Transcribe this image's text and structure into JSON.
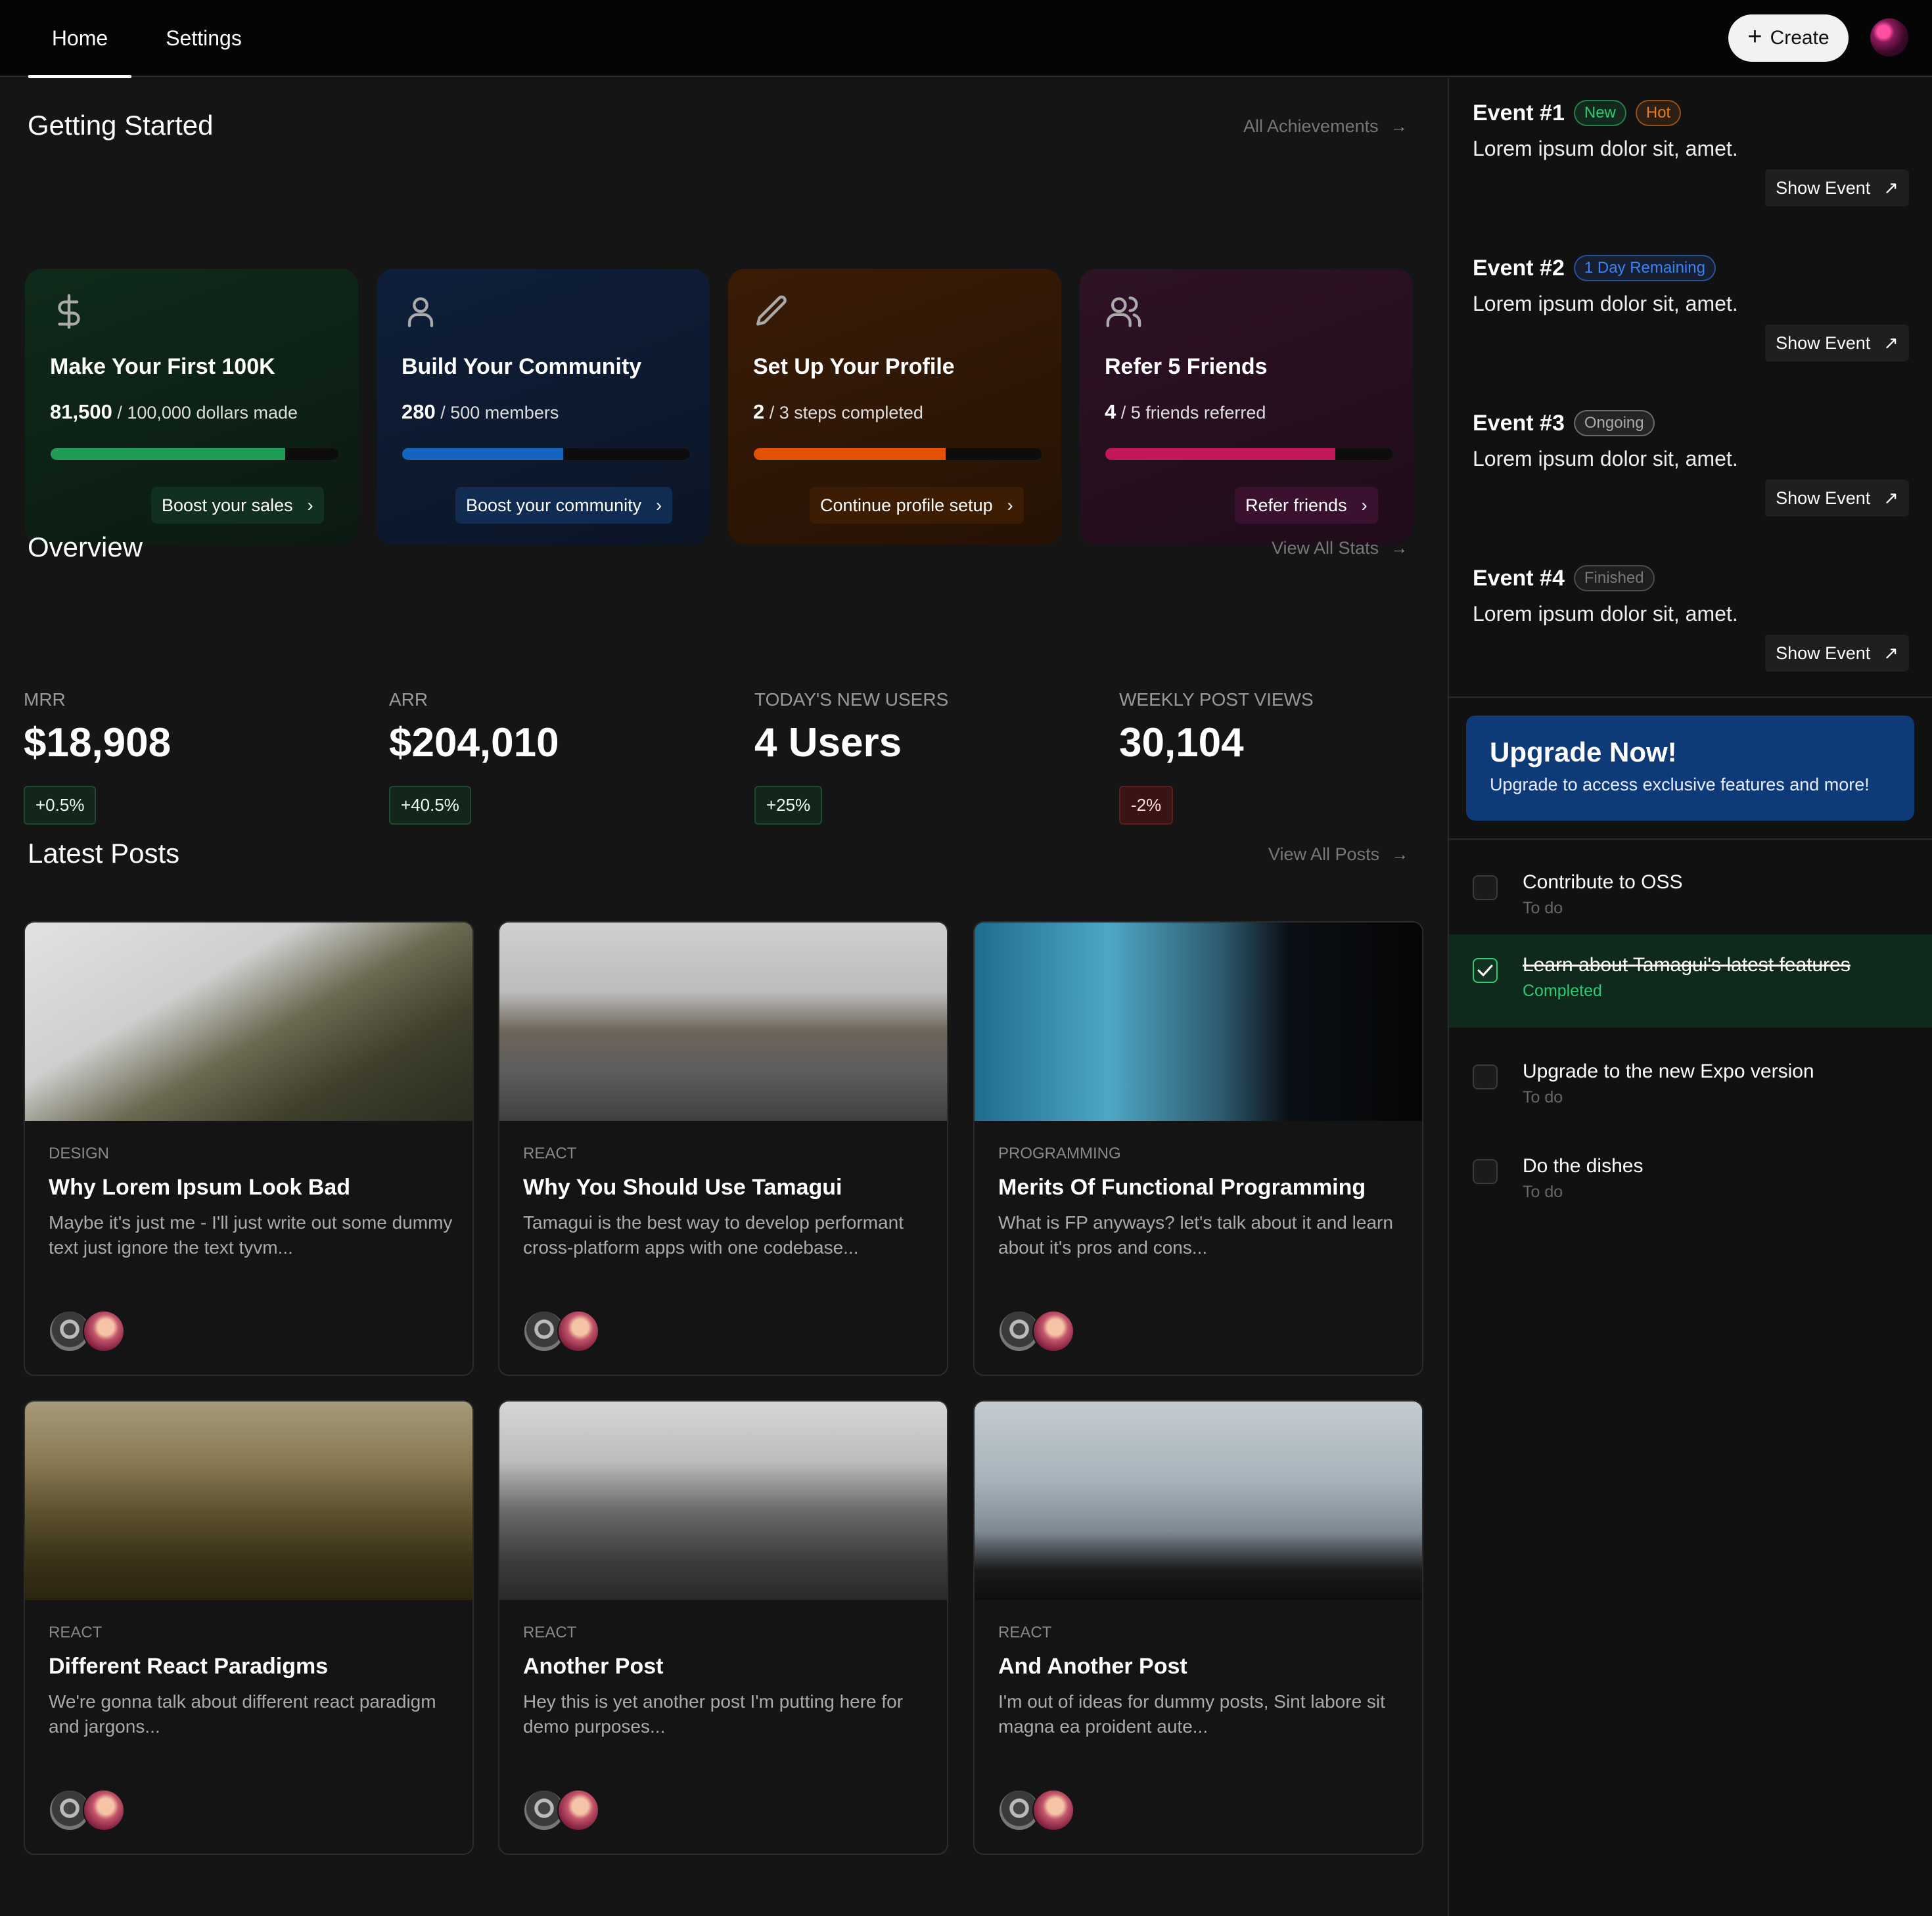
{
  "nav": {
    "tabs": [
      {
        "label": "Home"
      },
      {
        "label": "Settings"
      }
    ],
    "create_label": "Create"
  },
  "getting_started": {
    "title": "Getting Started",
    "link": "All Achievements",
    "cards": [
      {
        "icon": "dollar-icon",
        "title": "Make Your First 100K",
        "current": "81,500",
        "rest": "/ 100,000 dollars made",
        "progress": 0.815,
        "button": "Boost your sales",
        "accent": "#1f9d55"
      },
      {
        "icon": "user-icon",
        "title": "Build Your Community",
        "current": "280",
        "rest": "/ 500 members",
        "progress": 0.56,
        "button": "Boost your community",
        "accent": "#1565c0"
      },
      {
        "icon": "pencil-icon",
        "title": "Set Up Your Profile",
        "current": "2",
        "rest": "/ 3 steps completed",
        "progress": 0.667,
        "button": "Continue profile setup",
        "accent": "#e65100"
      },
      {
        "icon": "users-icon",
        "title": "Refer 5 Friends",
        "current": "4",
        "rest": "/ 5 friends referred",
        "progress": 0.8,
        "button": "Refer friends",
        "accent": "#c2185b"
      }
    ]
  },
  "overview": {
    "title": "Overview",
    "link": "View All Stats",
    "stats": [
      {
        "label": "MRR",
        "value": "$18,908",
        "change": "+0.5%",
        "positive": true
      },
      {
        "label": "ARR",
        "value": "$204,010",
        "change": "+40.5%",
        "positive": true
      },
      {
        "label": "Today's New Users",
        "value": "4 Users",
        "change": "+25%",
        "positive": true
      },
      {
        "label": "Weekly Post Views",
        "value": "30,104",
        "change": "-2%",
        "positive": false
      }
    ]
  },
  "posts": {
    "title": "Latest Posts",
    "link": "View All Posts",
    "items": [
      {
        "category": "Design",
        "title": "Why Lorem Ipsum Look Bad",
        "desc": "Maybe it's just me - I'll just write out some dummy text just ignore the text tyvm..."
      },
      {
        "category": "React",
        "title": "Why You Should Use Tamagui",
        "desc": "Tamagui is the best way to develop performant cross-platform apps with one codebase..."
      },
      {
        "category": "Programming",
        "title": "Merits Of Functional Programming",
        "desc": "What is FP anyways? let's talk about it and learn about it's pros and cons..."
      },
      {
        "category": "React",
        "title": "Different React Paradigms",
        "desc": "We're gonna talk about different react paradigm and jargons..."
      },
      {
        "category": "React",
        "title": "Another Post",
        "desc": "Hey this is yet another post I'm putting here for demo purposes..."
      },
      {
        "category": "React",
        "title": "And Another Post",
        "desc": "I'm out of ideas for dummy posts, Sint labore sit magna ea proident aute..."
      }
    ]
  },
  "events": [
    {
      "title": "Event #1",
      "tags": [
        {
          "label": "New",
          "color": "#2ecc71"
        },
        {
          "label": "Hot",
          "color": "#e67e22"
        }
      ],
      "desc": "Lorem ipsum dolor sit, amet.",
      "button": "Show Event"
    },
    {
      "title": "Event #2",
      "tags": [
        {
          "label": "1 Day Remaining",
          "color": "#3b82f6"
        }
      ],
      "desc": "Lorem ipsum dolor sit, amet.",
      "button": "Show Event"
    },
    {
      "title": "Event #3",
      "tags": [
        {
          "label": "Ongoing",
          "color": "#aaaaaa"
        }
      ],
      "desc": "Lorem ipsum dolor sit, amet.",
      "button": "Show Event"
    },
    {
      "title": "Event #4",
      "tags": [
        {
          "label": "Finished",
          "color": "#777777"
        }
      ],
      "desc": "Lorem ipsum dolor sit, amet.",
      "button": "Show Event"
    }
  ],
  "upgrade": {
    "title": "Upgrade Now!",
    "subtitle": "Upgrade to access exclusive features and more!"
  },
  "todos": [
    {
      "name": "Contribute to OSS",
      "status": "To do",
      "done": false
    },
    {
      "name": "Learn about Tamagui's latest features",
      "status": "Completed",
      "done": true
    },
    {
      "name": "Upgrade to the new Expo version",
      "status": "To do",
      "done": false
    },
    {
      "name": "Do the dishes",
      "status": "To do",
      "done": false
    }
  ]
}
